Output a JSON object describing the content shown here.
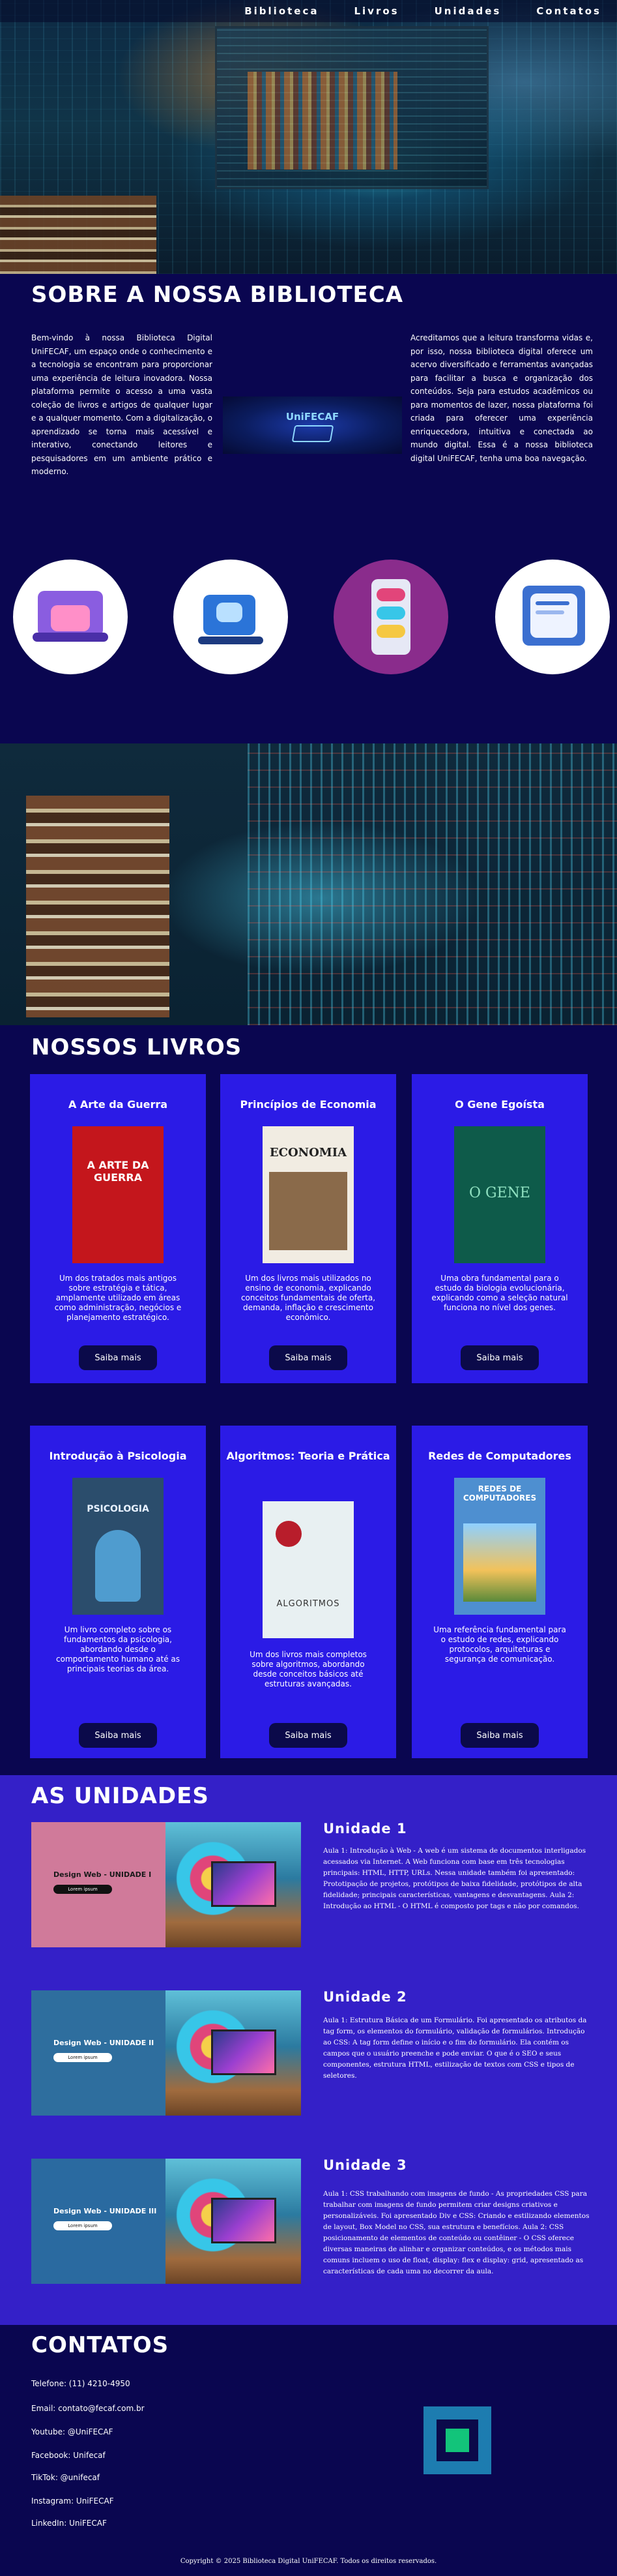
{
  "nav": {
    "items": [
      "Biblioteca",
      "Livros",
      "Unidades",
      "Contatos"
    ]
  },
  "sobre": {
    "title": "SOBRE A NOSSA BIBLIOTECA",
    "paragraph_left": "Bem-vindo à nossa Biblioteca Digital UniFECAF, um espaço onde o conhecimento e a tecnologia se encontram para proporcionar uma experiência de leitura inovadora. Nossa plataforma permite o acesso a uma vasta coleção de livros e artigos de qualquer lugar e a qualquer momento. Com a digitalização, o aprendizado se torna mais acessível e interativo, conectando leitores e pesquisadores em um ambiente prático e moderno.",
    "paragraph_right": "Acreditamos que a leitura transforma vidas e, por isso, nossa biblioteca digital oferece um acervo diversificado e ferramentas avançadas para facilitar a busca e organização dos conteúdos. Seja para estudos acadêmicos ou para momentos de lazer, nossa plataforma foi criada para oferecer uma experiência enriquecedora, intuitiva e conectada ao mundo digital. Essa é a nossa biblioteca digital UniFECAF, tenha uma boa navegação.",
    "logo_text": "UniFECAF"
  },
  "livros": {
    "title": "NOSSOS LIVROS",
    "button_label": "Saiba mais",
    "books": [
      {
        "title": "A Arte da Guerra",
        "description": "Um dos tratados mais antigos sobre estratégia e tática, amplamente utilizado em áreas como administração, negócios e planejamento estratégico.",
        "cover_title": "A ARTE DA GUERRA",
        "cover_color": "#c4161c"
      },
      {
        "title": "Princípios de Economia",
        "description": "Um dos livros mais utilizados no ensino de economia, explicando conceitos fundamentais de oferta, demanda, inflação e crescimento econômico.",
        "cover_title": "ECONOMIA",
        "cover_color": "#f1ece2"
      },
      {
        "title": "O Gene Egoísta",
        "description": "Uma obra fundamental para o estudo da biologia evolucionária, explicando como a seleção natural funciona no nível dos genes.",
        "cover_title": "O GENE",
        "cover_color": "#0e5b4a"
      },
      {
        "title": "Introdução à Psicologia",
        "description": "Um livro completo sobre os fundamentos da psicologia, abordando desde o comportamento humano até as principais teorias da área.",
        "cover_title": "PSICOLOGIA",
        "cover_color": "#2b4d6c"
      },
      {
        "title": "Algoritmos: Teoria e Prática",
        "description": "Um dos livros mais completos sobre algoritmos, abordando desde conceitos básicos até estruturas avançadas.",
        "cover_title": "ALGORITMOS",
        "cover_color": "#e8f0f2"
      },
      {
        "title": "Redes de Computadores",
        "description": "Uma referência fundamental para o estudo de redes, explicando protocolos, arquiteturas e segurança de comunicação.",
        "cover_title": "REDES DE COMPUTADORES",
        "cover_color": "#4e8fd0"
      }
    ]
  },
  "unidades": {
    "title": "AS UNIDADES",
    "units": [
      {
        "title": "Unidade 1",
        "img_label": "Design Web - UNIDADE I",
        "img_color": "#d07a9a",
        "text": "Aula 1: Introdução à Web - A web é um sistema de documentos interligados acessados via Internet. A Web funciona com base em três tecnologias principais: HTML, HTTP, URLs. Nessa unidade também foi apresentado: Prototipação de projetos, protótipos de baixa fidelidade, protótipos de alta fidelidade; principais características, vantagens e desvantagens. Aula 2: Introdução ao HTML - O HTML é composto por tags e não por comandos."
      },
      {
        "title": "Unidade 2",
        "img_label": "Design Web - UNIDADE II",
        "img_color": "#2e6e9e",
        "text": "Aula 1: Estrutura Básica de um Formulário. Foi apresentado os atributos da tag form, os elementos do formulário, validação de formulários. Introdução ao CSS: A tag form define o início e o fim do formulário. Ela contém os campos que o usuário preenche e pode enviar. O que é o SEO e seus componentes, estrutura HTML, estilização de textos com CSS e tipos de seletores."
      },
      {
        "title": "Unidade 3",
        "img_label": "Design Web - UNIDADE III",
        "img_color": "#2a6aa0",
        "text": "Aula 1: CSS trabalhando com imagens de fundo - As propriedades CSS para trabalhar com imagens de fundo permitem criar designs criativos e personalizáveis. Foi apresentado Div e CSS: Criando e estilizando elementos de layout, Box Model no CSS, sua estrutura e benefícios. Aula 2: CSS posicionamento de elementos de conteúdo ou contêiner - O CSS oferece diversas maneiras de alinhar e organizar conteúdos, e os métodos mais comuns incluem o uso de float, display: flex e display: grid, apresentado as características de cada uma no decorrer da aula."
      }
    ]
  },
  "contatos": {
    "title": "CONTATOS",
    "items": [
      "Telefone: (11) 4210-4950",
      "Email: contato@fecaf.com.br",
      "Youtube: @UniFECAF",
      "Facebook: Unifecaf",
      "TikTok: @unifecaf",
      "Instagram: UniFECAF",
      "LinkedIn: UniFECAF"
    ]
  },
  "footer": {
    "copyright": "Copyright © 2025 Biblioteca Digital UniFECAF. Todos os direitos reservados."
  }
}
